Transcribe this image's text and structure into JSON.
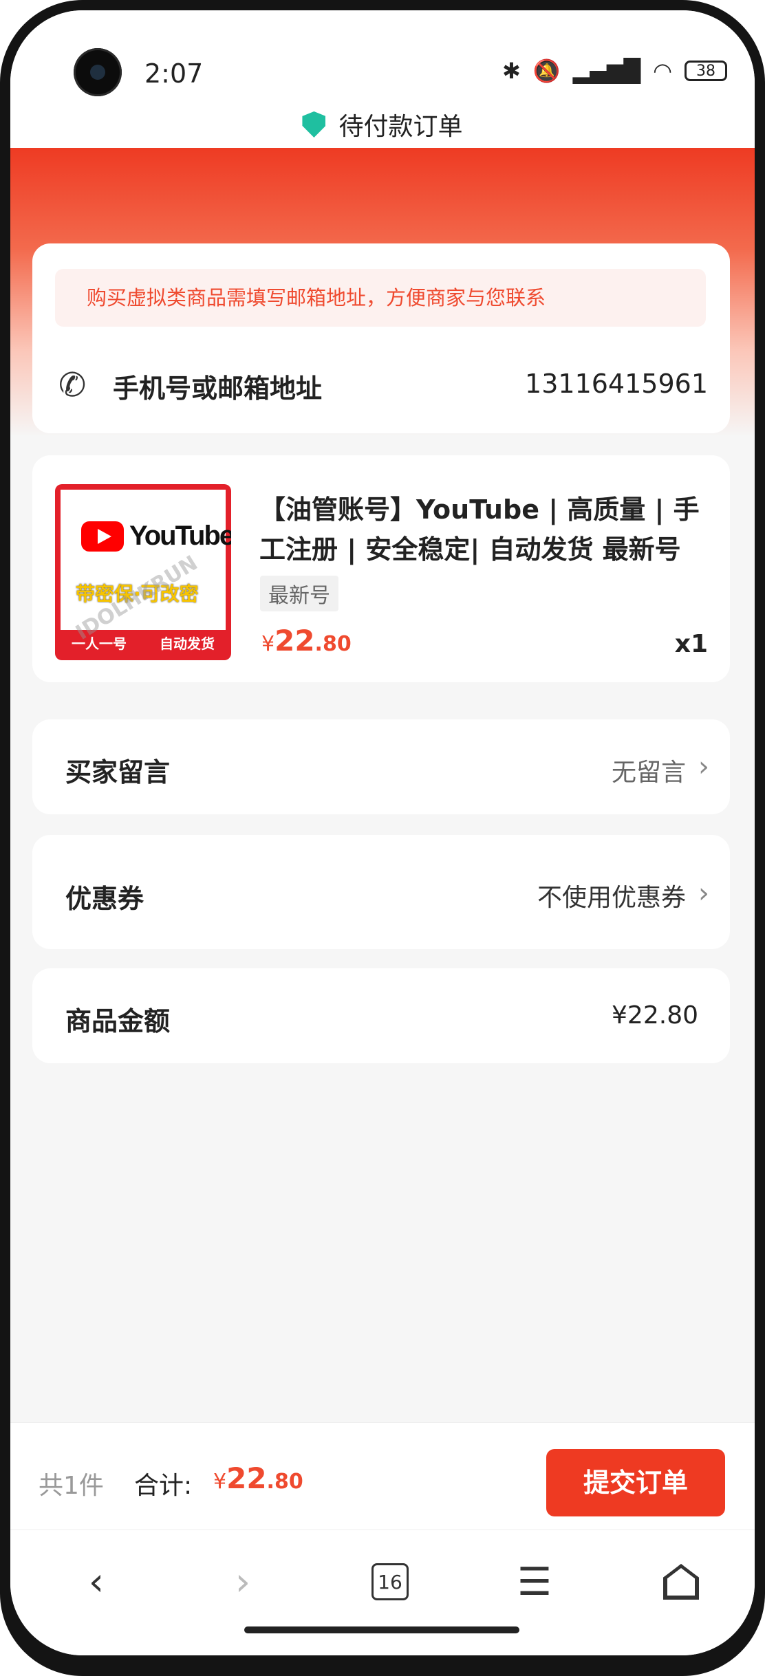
{
  "status_bar": {
    "time": "2:07",
    "battery": "38",
    "icons": [
      "bluetooth-icon",
      "mute-icon",
      "hd-signal-icon",
      "wifi-icon",
      "battery-icon"
    ]
  },
  "header": {
    "title": "待付款订单",
    "icon": "shield-icon"
  },
  "contact": {
    "notice": "购买虚拟类商品需填写邮箱地址，方便商家与您联系",
    "label": "手机号或邮箱地址",
    "value": "13116415961"
  },
  "product": {
    "title": "【油管账号】YouTube | 高质量 | 手工注册 | 安全稳定| 自动发货 最新号",
    "variant": "最新号",
    "price_symbol": "¥",
    "price_int": "22",
    "price_dec": ".80",
    "quantity": "x1",
    "thumbnail": {
      "brand": "YouTube",
      "subtitle": "带密保·可改密",
      "footer_left": "一人一号",
      "footer_right": "自动发货",
      "watermark": "IDOLHKRUN"
    }
  },
  "buyer_message": {
    "label": "买家留言",
    "value": "无留言"
  },
  "coupon": {
    "label": "优惠券",
    "value": "不使用优惠券"
  },
  "amount": {
    "label": "商品金额",
    "value": "¥22.80"
  },
  "checkout": {
    "count": "共1件",
    "total_label": "合计:",
    "total_symbol": "¥",
    "total_int": "22",
    "total_dec": ".80",
    "submit_label": "提交订单"
  },
  "browser": {
    "tab_count": "16"
  },
  "colors": {
    "accent": "#ee3a22",
    "price": "#ef4a2f",
    "notice_bg": "#fdf1ef"
  }
}
